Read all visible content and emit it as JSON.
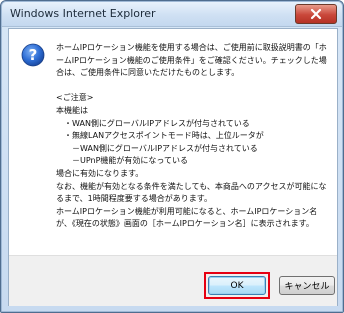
{
  "window": {
    "title": "Windows Internet Explorer"
  },
  "dialog": {
    "icon": "question-icon",
    "message": "ホームIPロケーション機能を使用する場合は、ご使用前に取扱説明書の「ホームIPロケーション機能のご使用条件」をご確認ください。チェックした場合は、ご使用条件に同意いただけたものとします。\n\n<ご注意>\n本機能は\n　・WAN側にグローバルIPアドレスが付与されている\n　・無線LANアクセスポイントモード時は、上位ルータが\n　　－WAN側にグローバルIPアドレスが付与されている\n　　－UPnP機能が有効になっている\n場合に有効になります。\nなお、機能が有効となる条件を満たしても、本商品へのアクセスが可能になるまで、1時間程度要する場合があります。\nホームIPロケーション機能が利用可能になると、ホームIPロケーション名が、《現在の状態》画面の［ホームIPロケーション名］に表示されます。"
  },
  "buttons": {
    "ok": "OK",
    "cancel": "キャンセル"
  },
  "colors": {
    "highlight": "#e60012",
    "icon_blue": "#2f6fd6",
    "close_red": "#c9473a"
  }
}
